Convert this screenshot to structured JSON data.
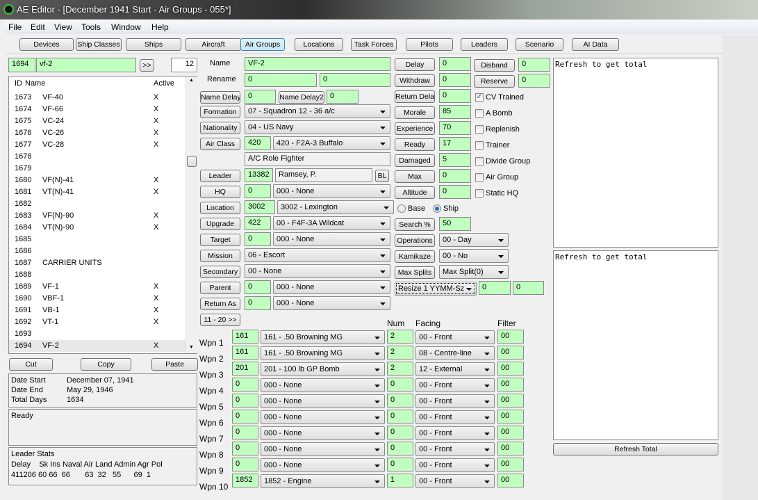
{
  "window": {
    "title": "AE Editor - [December 1941 Start - Air Groups - 055*]"
  },
  "menu": [
    "File",
    "Edit",
    "View",
    "Tools",
    "Window",
    "Help"
  ],
  "toolbar": [
    "Devices",
    "Ship Classes",
    "Ships",
    "Aircraft",
    "Air Groups",
    "Locations",
    "Task Forces",
    "Pilots",
    "Leaders",
    "Scenario",
    "AI Data"
  ],
  "search": {
    "id": "1694",
    "name": "vf-2",
    "next": ">>",
    "count": "12"
  },
  "list": {
    "headers": [
      "ID",
      "Name",
      "Active"
    ],
    "rows": [
      [
        "1673",
        "VF-40",
        "X"
      ],
      [
        "1674",
        "VF-66",
        "X"
      ],
      [
        "1675",
        "VC-24",
        "X"
      ],
      [
        "1676",
        "VC-26",
        "X"
      ],
      [
        "1677",
        "VC-28",
        "X"
      ],
      [
        "1678",
        "",
        ""
      ],
      [
        "1679",
        "",
        ""
      ],
      [
        "1680",
        "VF(N)-41",
        "X"
      ],
      [
        "1681",
        "VT(N)-41",
        "X"
      ],
      [
        "1682",
        "",
        ""
      ],
      [
        "1683",
        "VF(N)-90",
        "X"
      ],
      [
        "1684",
        "VT(N)-90",
        "X"
      ],
      [
        "1685",
        "",
        ""
      ],
      [
        "1686",
        "",
        ""
      ],
      [
        "1687",
        "CARRIER UNITS",
        ""
      ],
      [
        "1688",
        "",
        ""
      ],
      [
        "1689",
        "VF-1",
        "X"
      ],
      [
        "1690",
        "VBF-1",
        "X"
      ],
      [
        "1691",
        "VB-1",
        "X"
      ],
      [
        "1692",
        "VT-1",
        "X"
      ],
      [
        "1693",
        "",
        ""
      ],
      [
        "1694",
        "VF-2",
        "X"
      ]
    ]
  },
  "list_buttons": {
    "cut": "Cut",
    "copy": "Copy",
    "paste": "Paste"
  },
  "dates": {
    "start_label": "Date Start",
    "start": "December 07, 1941",
    "end_label": "Date End",
    "end": "May 29, 1946",
    "days_label": "Total Days",
    "days": "1634"
  },
  "status": "Ready",
  "leader_stats": {
    "title": "Leader Stats",
    "header": "Delay    Sk Ins Naval Air Land Admin Agr Pol",
    "values": "411206 60 66  66       63  32   55      69  1"
  },
  "form": {
    "name_label": "Name",
    "name": "VF-2",
    "rename_label": "Rename",
    "rename1": "0",
    "rename2": "0",
    "name_delay_btn": "Name Delay",
    "name_delay": "0",
    "name_delay2_btn": "Name Delay2",
    "name_delay2": "0",
    "formation_btn": "Formation",
    "formation": "07 - Squadron 12 - 36 a/c",
    "nationality_btn": "Nationality",
    "nationality": "04 - US Navy",
    "air_class_btn": "Air Class",
    "air_class_id": "420",
    "air_class": "420 - F2A-3 Buffalo",
    "ac_role": "A/C Role   Fighter",
    "leader_btn": "Leader",
    "leader_id": "13382",
    "leader_name": "Ramsey, P.",
    "bl_btn": "BL",
    "hq_btn": "HQ",
    "hq_id": "0",
    "hq": "000 - None",
    "location_btn": "Location",
    "location_id": "3002",
    "location": "3002 - Lexington",
    "base_label": "Base",
    "ship_label": "Ship",
    "upgrade_btn": "Upgrade",
    "upgrade_id": "422",
    "upgrade": "00 - F4F-3A Wildcat",
    "target_btn": "Target",
    "target_id": "0",
    "target": "000 - None",
    "mission_btn": "Mission",
    "mission": "06 - Escort",
    "secondary_btn": "Secondary",
    "secondary": "00 - None",
    "parent_btn": "Parent",
    "parent_id": "0",
    "parent": "000 - None",
    "return_as_btn": "Return As",
    "return_as_id": "0",
    "return_as": "000 - None",
    "more_btn": "11 - 20 >>",
    "delay_btn": "Delay",
    "delay": "0",
    "withdraw_btn": "Withdraw",
    "withdraw": "0",
    "return_delay_btn": "Return Delay",
    "return_delay": "0",
    "morale_btn": "Morale",
    "morale": "85",
    "experience_btn": "Experience",
    "experience": "70",
    "ready_btn": "Ready",
    "ready": "17",
    "damaged_btn": "Damaged",
    "damaged": "5",
    "max_btn": "Max",
    "max": "0",
    "altitude_btn": "Altitude",
    "altitude": "0",
    "search_btn": "Search %",
    "search": "50",
    "operations_btn": "Operations",
    "operations": "00 - Day",
    "kamikaze_btn": "Kamikaze",
    "kamikaze": "00 - No",
    "max_splits_btn": "Max Splits",
    "max_splits": "Max Split(0)",
    "resize": "Resize 1 YYMM-Sz",
    "resize1": "0",
    "resize2": "0",
    "disband_btn": "Disband",
    "disband": "0",
    "reserve_btn": "Reserve",
    "reserve": "0"
  },
  "checks": [
    {
      "label": "CV Trained",
      "checked": true
    },
    {
      "label": "A Bomb",
      "checked": false
    },
    {
      "label": "Replenish",
      "checked": false
    },
    {
      "label": "Trainer",
      "checked": false
    },
    {
      "label": "Divide Group",
      "checked": false
    },
    {
      "label": "Air Group",
      "checked": false
    },
    {
      "label": "Static HQ",
      "checked": false
    }
  ],
  "weapons": {
    "headers": {
      "num": "Num",
      "facing": "Facing",
      "filter": "Filter"
    },
    "rows": [
      {
        "label": "Wpn 1",
        "id": "161",
        "device": "161 - .50 Browning MG",
        "num": "2",
        "facing": "00 - Front",
        "filter": "00"
      },
      {
        "label": "Wpn 2",
        "id": "161",
        "device": "161 - .50 Browning MG",
        "num": "2",
        "facing": "08 - Centre-line",
        "filter": "00"
      },
      {
        "label": "Wpn 3",
        "id": "201",
        "device": "201 - 100 lb GP Bomb",
        "num": "2",
        "facing": "12 - External",
        "filter": "00"
      },
      {
        "label": "Wpn 4",
        "id": "0",
        "device": "000 - None",
        "num": "0",
        "facing": "00 - Front",
        "filter": "00"
      },
      {
        "label": "Wpn 5",
        "id": "0",
        "device": "000 - None",
        "num": "0",
        "facing": "00 - Front",
        "filter": "00"
      },
      {
        "label": "Wpn 6",
        "id": "0",
        "device": "000 - None",
        "num": "0",
        "facing": "00 - Front",
        "filter": "00"
      },
      {
        "label": "Wpn 7",
        "id": "0",
        "device": "000 - None",
        "num": "0",
        "facing": "00 - Front",
        "filter": "00"
      },
      {
        "label": "Wpn 8",
        "id": "0",
        "device": "000 - None",
        "num": "0",
        "facing": "00 - Front",
        "filter": "00"
      },
      {
        "label": "Wpn 9",
        "id": "0",
        "device": "000 - None",
        "num": "0",
        "facing": "00 - Front",
        "filter": "00"
      },
      {
        "label": "Wpn 10",
        "id": "1852",
        "device": "1852 - Engine",
        "num": "1",
        "facing": "00 - Front",
        "filter": "00"
      }
    ]
  },
  "totals": {
    "text1": "Refresh to get total",
    "text2": "Refresh to get total",
    "refresh_btn": "Refresh Total"
  }
}
